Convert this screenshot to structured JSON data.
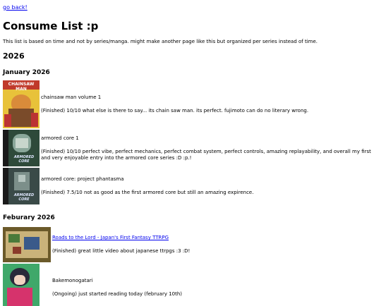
{
  "nav": {
    "back_label": "go back!"
  },
  "page": {
    "title": "Consume List :p",
    "intro": "This list is based on time and not by series/manga. might make another page like this but organized per series instead of time."
  },
  "years": [
    {
      "label": "2026",
      "months": [
        {
          "label": "January 2026",
          "entries": [
            {
              "title": "chainsaw man volume 1",
              "status": "(Finished) 10/10 what else is there to say... its chain saw man. its perfect. fujimoto can do no literary wrong.",
              "cover_text": "CHAINSAW MAN"
            },
            {
              "title": "armored core 1",
              "status": "(Finished) 10/10 perfect vibe, perfect mechanics, perfect combat system, perfect controls, amazing replayability, and overall my first and very enjoyable entry into the armored core series :D :p.!",
              "cover_text": "ARMORED CORE"
            },
            {
              "title": "armored core: project phantasma",
              "status": "(Finished) 7.5/10 not as good as the first armored core but still an amazing expirence.",
              "cover_text": "ARMORED CORE"
            }
          ]
        },
        {
          "label": "Feburary 2026",
          "entries": [
            {
              "title": "Roads to the Lord - Japan's First Fantasy TTRPG",
              "status": "(Finished) great little video about japanese ttrpgs :3 :D!"
            },
            {
              "title": "Bakemonogatari",
              "status": "(Ongoing) just started reading today (february 10th)"
            }
          ]
        }
      ]
    }
  ],
  "colors": {
    "link": "#0000ee",
    "chainsaw_bg": "#e8c23a",
    "chainsaw_accent": "#c0392b",
    "ps_strip": "#1a1a1a",
    "ac_bg": "#2e4a3a",
    "roads_bg": "#6b5a2a",
    "bake_bg": "#3fa86a"
  }
}
